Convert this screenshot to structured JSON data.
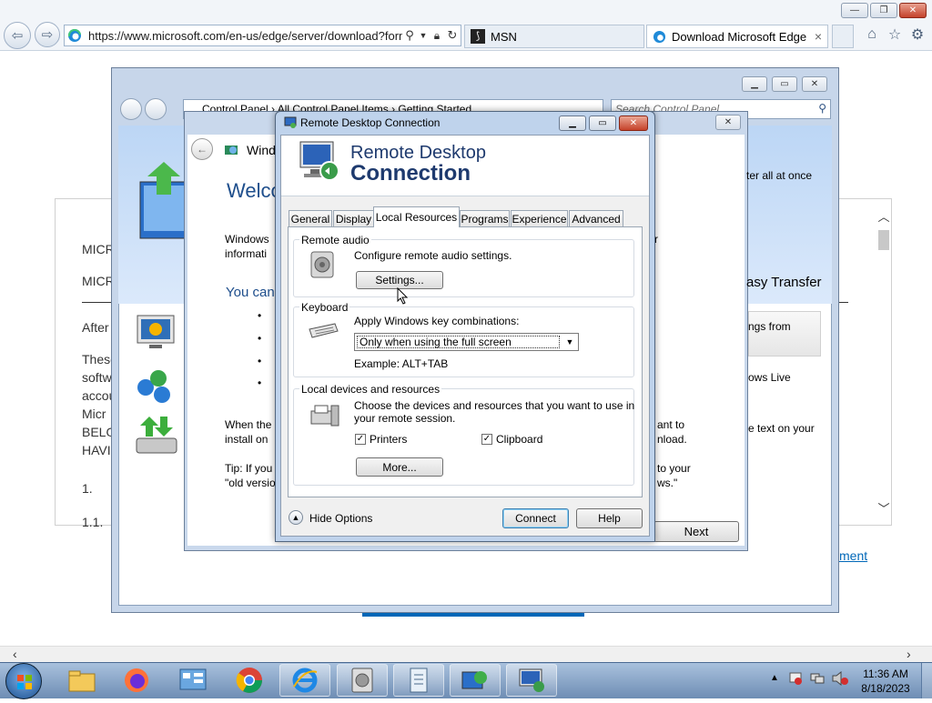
{
  "browser": {
    "url": "https://www.microsoft.com/en-us/edge/server/download?form",
    "tabs": [
      {
        "label": "MSN"
      },
      {
        "label": "Download Microsoft Edge"
      }
    ],
    "tab_close": "×"
  },
  "background_page": {
    "lines": [
      "MICR",
      "MICR",
      "After",
      "These",
      "softw",
      "accou",
      "Micr",
      "BELO",
      "HAVI",
      "1.",
      "1.1."
    ],
    "link_fragment": "ment"
  },
  "control_panel": {
    "address": "Control Panel  ›  All Control Panel Items  ›  Getting Started",
    "search_placeholder": "Search Control Panel"
  },
  "easy_transfer": {
    "title_fragment": "Windo",
    "heading_fragment": "Welco",
    "body1_a": "Windows",
    "body1_b": "informati",
    "body1_tail": "r",
    "subheading": "You can",
    "bullets": [
      "•",
      "•",
      "•",
      "•"
    ],
    "right_texts": [
      "ter all at once",
      "asy Transfer",
      "ngs from",
      "ows Live",
      "e text on your"
    ],
    "para2_a": "When the",
    "para2_b": "install on",
    "para2_tail_a": "ant to",
    "para2_tail_b": "nload.",
    "tip_a": "Tip: If you",
    "tip_b": "\"old versio",
    "tip_tail_a": "to your",
    "tip_tail_b": "ws.\"",
    "next_button": "Next"
  },
  "rdc": {
    "title": "Remote Desktop Connection",
    "banner_line1": "Remote Desktop",
    "banner_line2": "Connection",
    "tabs": [
      "General",
      "Display",
      "Local Resources",
      "Programs",
      "Experience",
      "Advanced"
    ],
    "remote_audio": {
      "label": "Remote audio",
      "description": "Configure remote audio settings.",
      "settings_button": "Settings..."
    },
    "keyboard": {
      "label": "Keyboard",
      "description": "Apply Windows key combinations:",
      "selected": "Only when using the full screen",
      "example": "Example: ALT+TAB"
    },
    "local_devices": {
      "label": "Local devices and resources",
      "description_line1": "Choose the devices and resources that you want to use in",
      "description_line2": "your remote session.",
      "printers": "Printers",
      "clipboard": "Clipboard",
      "printers_checked": true,
      "clipboard_checked": true,
      "more_button": "More..."
    },
    "hide_options": "Hide Options",
    "connect_button": "Connect",
    "help_button": "Help"
  },
  "taskbar": {
    "time": "11:36 AM",
    "date": "8/18/2023"
  },
  "colors": {
    "accent": "#1e3a6e",
    "taskbar": "#6e8db4",
    "link": "#0067b8"
  }
}
